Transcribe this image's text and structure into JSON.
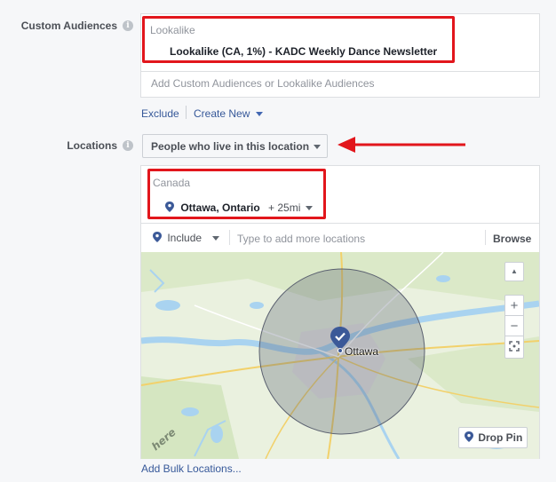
{
  "custom_audiences": {
    "label": "Custom Audiences",
    "info": "i",
    "group_label": "Lookalike",
    "selected_audience": "Lookalike (CA, 1%) - KADC Weekly Dance Newsletter",
    "placeholder": "Add Custom Audiences or Lookalike Audiences",
    "exclude_label": "Exclude",
    "create_new_label": "Create New"
  },
  "locations": {
    "label": "Locations",
    "info": "i",
    "dropdown_label": "People who live in this location",
    "country": "Canada",
    "selected_location": "Ottawa, Ontario",
    "radius": "+ 25mi",
    "include_label": "Include",
    "search_placeholder": "Type to add more locations",
    "browse_label": "Browse",
    "add_bulk_label": "Add Bulk Locations..."
  },
  "map": {
    "city_label": "Ottawa",
    "drop_pin_label": "Drop Pin",
    "watermark": "here",
    "zoom_in": "+",
    "zoom_out": "−",
    "collapse": "▲",
    "colors": {
      "water": "#a9d3f0",
      "land": "#eaf1df",
      "radius_fill": "rgba(80,90,110,0.35)",
      "pin": "#3b5998"
    }
  },
  "annotation": {
    "highlight_color": "#e2161c"
  }
}
